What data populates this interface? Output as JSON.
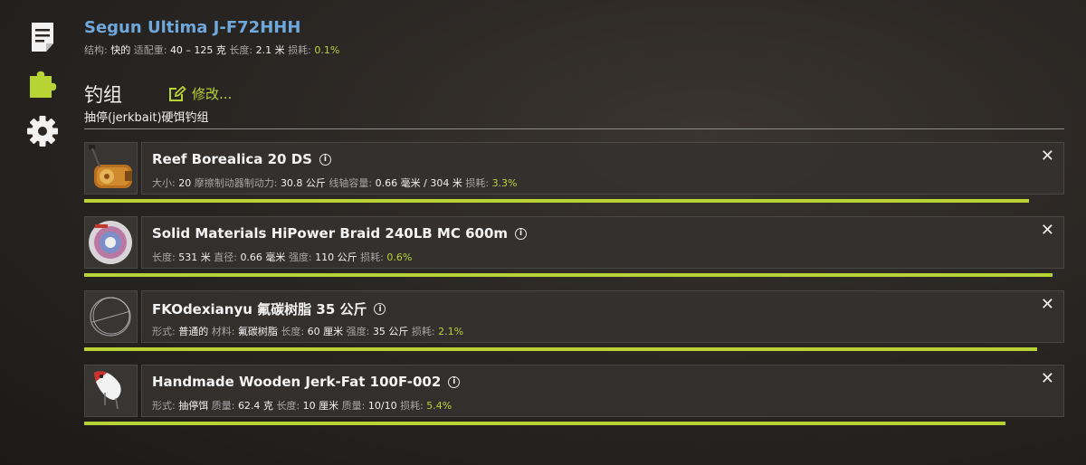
{
  "rod": {
    "title": "Segun Ultima J-F72HHH",
    "stats": [
      {
        "label": "结构:",
        "value": "快的"
      },
      {
        "label": "适配重:",
        "value": "40 – 125 克"
      },
      {
        "label": "长度:",
        "value": "2.1 米"
      },
      {
        "label": "损耗:",
        "value": "0.1%",
        "wear": true
      }
    ]
  },
  "rig": {
    "title": "钓组",
    "modify_label": "修改...",
    "type": "抽停(jerkbait)硬饵钓组"
  },
  "items": [
    {
      "name": "Reef Borealica 20 DS",
      "condition": 0.97,
      "stats": [
        {
          "label": "大小:",
          "value": "20"
        },
        {
          "label": "摩擦制动器制动力:",
          "value": "30.8 公斤"
        },
        {
          "label": "线轴容量:",
          "value": "0.66 毫米 / 304 米"
        },
        {
          "label": "损耗:",
          "value": "3.3%",
          "wear": true
        }
      ]
    },
    {
      "name": "Solid Materials HiPower Braid 240LB MC 600m",
      "condition": 0.994,
      "stats": [
        {
          "label": "长度:",
          "value": "531 米"
        },
        {
          "label": "直径:",
          "value": "0.66 毫米"
        },
        {
          "label": "强度:",
          "value": "110 公斤"
        },
        {
          "label": "损耗:",
          "value": "0.6%",
          "wear": true
        }
      ]
    },
    {
      "name": "FKOdexianyu 氟碳树脂 35 公斤",
      "condition": 0.979,
      "stats": [
        {
          "label": "形式:",
          "value": "普通的"
        },
        {
          "label": "材料:",
          "value": "氟碳树脂"
        },
        {
          "label": "长度:",
          "value": "60 厘米"
        },
        {
          "label": "强度:",
          "value": "35 公斤"
        },
        {
          "label": "损耗:",
          "value": "2.1%",
          "wear": true
        }
      ]
    },
    {
      "name": "Handmade Wooden Jerk-Fat 100F-002",
      "condition": 0.946,
      "stats": [
        {
          "label": "形式:",
          "value": "抽停饵"
        },
        {
          "label": "质量:",
          "value": "62.4 克"
        },
        {
          "label": "长度:",
          "value": "10 厘米"
        },
        {
          "label": "质量:",
          "value": "10/10"
        },
        {
          "label": "损耗:",
          "value": "5.4%",
          "wear": true
        }
      ]
    }
  ],
  "colors": {
    "accent": "#b7d334",
    "rod_title": "#6fa8dc"
  },
  "icons": {
    "sidebar": [
      "document-icon",
      "puzzle-icon",
      "gear-icon"
    ],
    "thumbnails": [
      "reel-icon",
      "braid-spool-icon",
      "leader-coil-icon",
      "lure-icon"
    ],
    "close": "close-icon",
    "info": "info-icon",
    "modify": "edit-icon"
  }
}
